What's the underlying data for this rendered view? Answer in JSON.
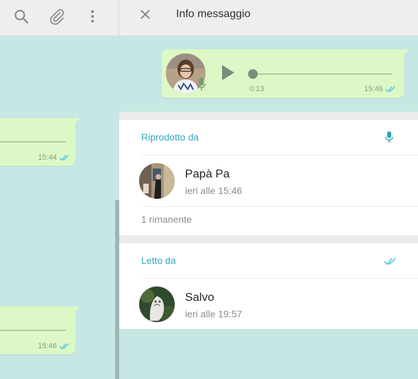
{
  "left_header": {
    "icons": [
      "search-icon",
      "attach-icon",
      "menu-icon"
    ]
  },
  "chat": {
    "messages": [
      {
        "time": "15:44",
        "status": "read"
      },
      {
        "time": "15:46",
        "status": "read"
      }
    ]
  },
  "info": {
    "title": "Info messaggio",
    "close_icon": "close-icon",
    "voice_message": {
      "duration": "0:13",
      "time": "15:46",
      "status": "read",
      "progress": 0
    },
    "played_by": {
      "title": "Riprodotto da",
      "icon": "mic-icon",
      "contacts": [
        {
          "name": "Papà Pa",
          "time": "ieri alle 15:46"
        }
      ],
      "remaining": "1 rimanente"
    },
    "read_by": {
      "title": "Letto da",
      "icon": "double-check-icon",
      "contacts": [
        {
          "name": "Salvo",
          "time": "ieri alle 19:57"
        }
      ]
    }
  },
  "colors": {
    "accent": "#33a6ba",
    "bubble": "#dcf8c6",
    "chat_background": "#c6e7e3",
    "read_ticks": "#4fc3f7"
  }
}
